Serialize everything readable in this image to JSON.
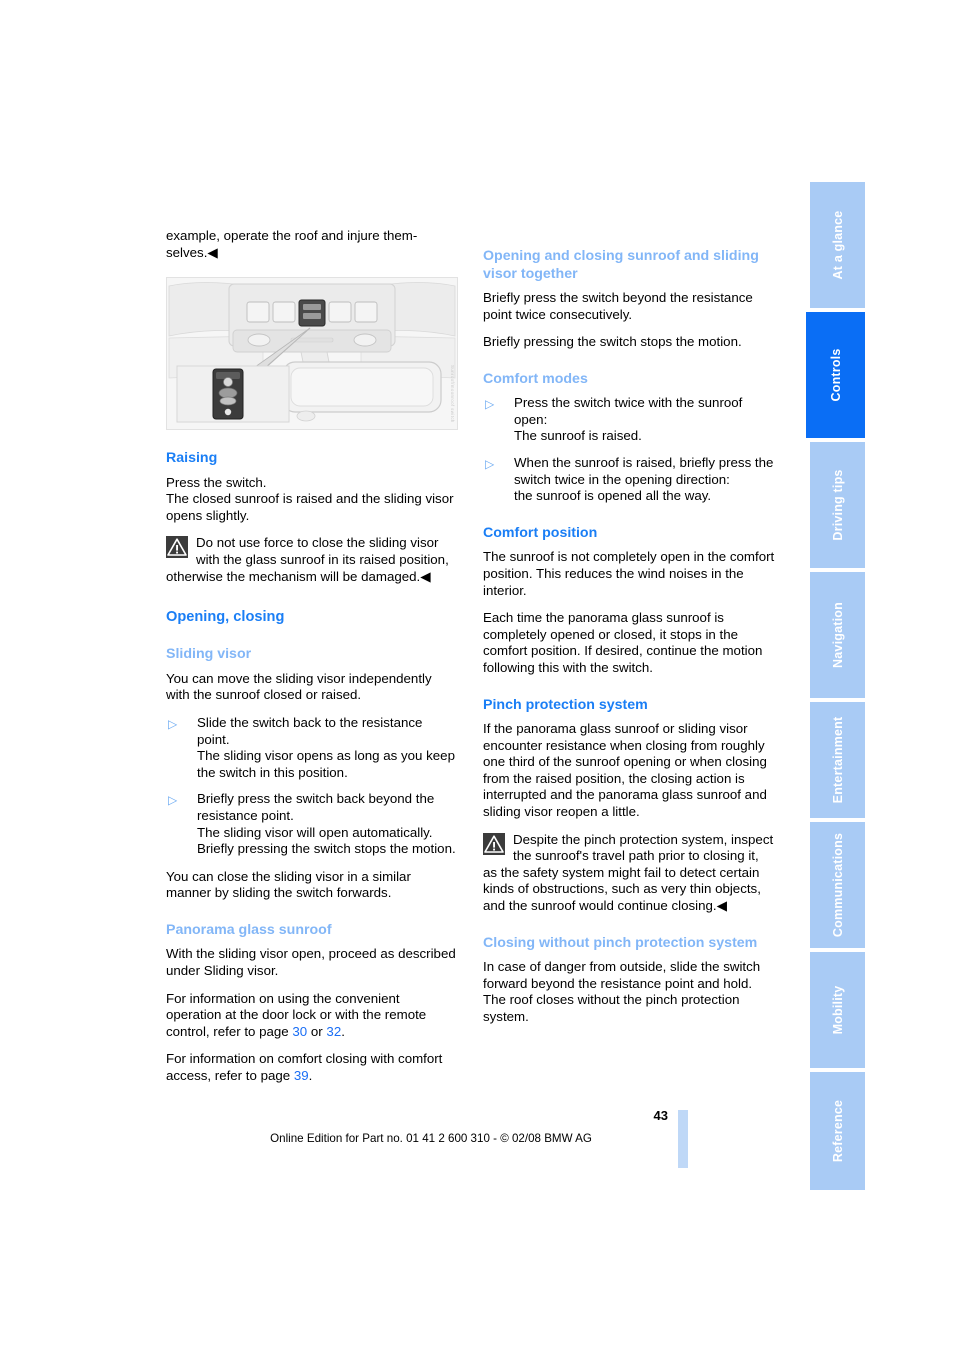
{
  "document": {
    "page_number": "43",
    "footer_text": "Online Edition for Part no. 01 41 2 600 310 - © 02/08 BMW AG",
    "figure_code": "Sunroof/moonroof switch"
  },
  "sidebar": {
    "tabs": [
      {
        "label": "At a glance",
        "active": false
      },
      {
        "label": "Controls",
        "active": true
      },
      {
        "label": "Driving tips",
        "active": false
      },
      {
        "label": "Navigation",
        "active": false
      },
      {
        "label": "Entertainment",
        "active": false
      },
      {
        "label": "Communications",
        "active": false
      },
      {
        "label": "Mobility",
        "active": false
      },
      {
        "label": "Reference",
        "active": false
      }
    ]
  },
  "colors": {
    "heading_strong": "#1a7ef5",
    "heading_light": "#82b6f7",
    "tab_inactive": "#a9cbf5",
    "tab_active": "#0a6ef5",
    "link": "#1a6ef5"
  },
  "left_column": {
    "continuation": "example, operate the roof and injure them-selves.",
    "continuation_endmark": "◀",
    "raising": {
      "heading": "Raising",
      "p1": "Press the switch.",
      "p2": "The closed sunroof is raised and the sliding visor opens slightly.",
      "warning": "Do not use force to close the sliding visor with the glass sunroof in its raised position, otherwise the mechanism will be damaged.",
      "warning_endmark": "◀"
    },
    "opening_closing": {
      "heading": "Opening, closing",
      "sliding_visor": {
        "heading": "Sliding visor",
        "intro": "You can move the sliding visor independently with the sunroof closed or raised.",
        "bullets": [
          "Slide the switch back to the resistance point.\nThe sliding visor opens as long as you keep the switch in this position.",
          "Briefly press the switch back beyond the resistance point.\nThe sliding visor will open automatically. Briefly pressing the switch stops the motion."
        ],
        "outro": "You can close the sliding visor in a similar manner by sliding the switch forwards."
      },
      "panorama": {
        "heading": "Panorama glass sunroof",
        "p1": "With the sliding visor open, proceed as described under Sliding visor.",
        "p2_part1": "For information on using the convenient operation at the door lock or with the remote control, refer to page ",
        "p2_link1": "30",
        "p2_mid": " or ",
        "p2_link2": "32",
        "p2_end": ".",
        "p3_part1": "For information on comfort closing with comfort access, refer to page ",
        "p3_link": "39",
        "p3_end": "."
      }
    }
  },
  "right_column": {
    "together": {
      "heading": "Opening and closing sunroof and sliding visor together",
      "p1": "Briefly press the switch beyond the resistance point twice consecutively.",
      "p2": "Briefly pressing the switch stops the motion."
    },
    "comfort_modes": {
      "heading": "Comfort modes",
      "bullets": [
        "Press the switch twice with the sunroof open:\nThe sunroof is raised.",
        "When the sunroof is raised, briefly press the switch twice in the opening direction:\nthe sunroof is opened all the way."
      ]
    },
    "comfort_position": {
      "heading": "Comfort position",
      "p1": "The sunroof is not completely open in the comfort position. This reduces the wind noises in the interior.",
      "p2": "Each time the panorama glass sunroof is completely opened or closed, it stops in the comfort position. If desired, continue the motion following this with the switch."
    },
    "pinch_protection": {
      "heading": "Pinch protection system",
      "p1": "If the panorama glass sunroof or sliding visor encounter resistance when closing from roughly one third of the sunroof opening or when closing from the raised position, the closing action is interrupted and the panorama glass sunroof and sliding visor reopen a little.",
      "warning": "Despite the pinch protection system, inspect the sunroof's travel path prior to closing it, as the safety system might fail to detect certain kinds of obstructions, such as very thin objects, and the sunroof would continue closing.",
      "warning_endmark": "◀"
    },
    "closing_without": {
      "heading": "Closing without pinch protection system",
      "p1": "In case of danger from outside, slide the switch forward beyond the resistance point and hold. The roof closes without the pinch protection system."
    }
  }
}
